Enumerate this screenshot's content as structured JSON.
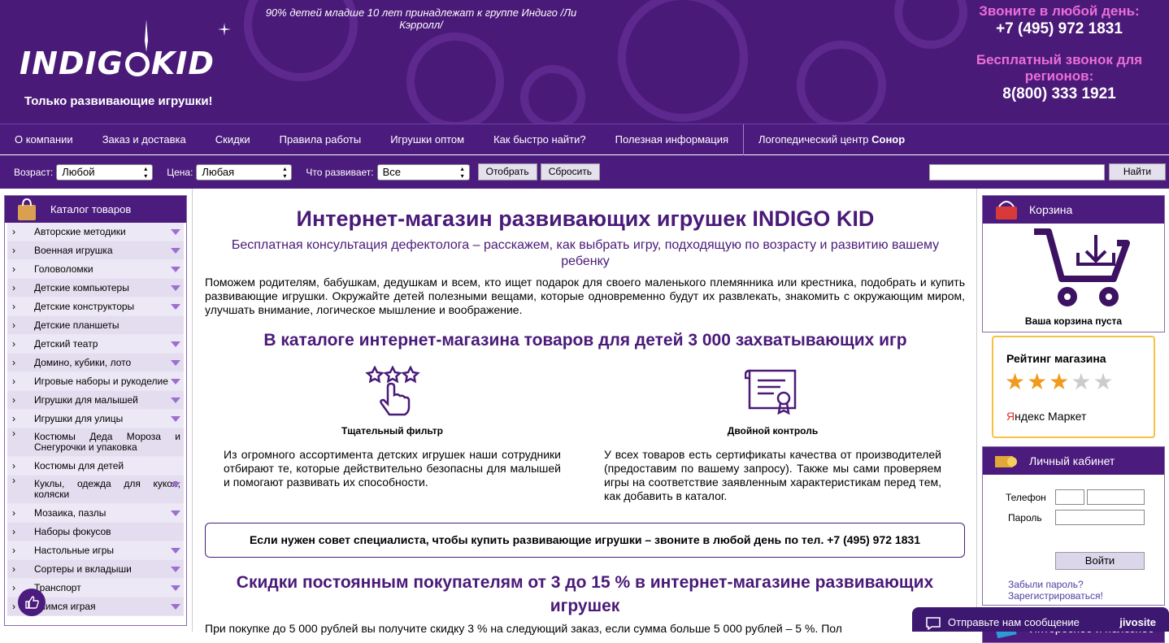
{
  "header": {
    "logo_left": "INDIG",
    "logo_right": "KID",
    "slogan": "Только развивающие игрушки!",
    "quote": "90% детей младше 10 лет принадлежат к группе Индиго /Ли Кэрролл/",
    "call_any_day": "Звоните в любой день:",
    "phone_main": "+7 (495) 972 1831",
    "free_call": "Бесплатный звонок для регионов:",
    "phone_free": "8(800) 333 1921"
  },
  "nav": {
    "items": [
      "О компании",
      "Заказ и доставка",
      "Скидки",
      "Правила работы",
      "Игрушки оптом",
      "Как быстро найти?",
      "Полезная информация"
    ],
    "logo_center_prefix": "Логопедический центр ",
    "logo_center_name": "Сонор"
  },
  "filter": {
    "age_label": "Возраст:",
    "age_value": "Любой",
    "price_label": "Цена:",
    "price_value": "Любая",
    "develops_label": "Что развивает:",
    "develops_value": "Все",
    "apply": "Отобрать",
    "reset": "Сбросить",
    "search_button": "Найти",
    "search_value": ""
  },
  "catalog": {
    "title": "Каталог товаров",
    "items": [
      {
        "label": "Авторские методики",
        "sub": true
      },
      {
        "label": "Военная игрушка",
        "sub": true
      },
      {
        "label": "Головоломки",
        "sub": true
      },
      {
        "label": "Детские компьютеры",
        "sub": true
      },
      {
        "label": "Детские конструкторы",
        "sub": true
      },
      {
        "label": "Детские планшеты",
        "sub": false
      },
      {
        "label": "Детский театр",
        "sub": true
      },
      {
        "label": "Домино, кубики, лото",
        "sub": true
      },
      {
        "label": "Игровые наборы и рукоделие",
        "sub": true
      },
      {
        "label": "Игрушки для малышей",
        "sub": true
      },
      {
        "label": "Игрушки для улицы",
        "sub": true
      },
      {
        "label": "Костюмы Деда Мороза и Снегурочки и упаковка",
        "sub": false
      },
      {
        "label": "Костюмы для детей",
        "sub": false
      },
      {
        "label": "Куклы, одежда для кукол, коляски",
        "sub": true
      },
      {
        "label": "Мозаика, пазлы",
        "sub": true
      },
      {
        "label": "Наборы фокусов",
        "sub": false
      },
      {
        "label": "Настольные игры",
        "sub": true
      },
      {
        "label": "Сортеры и вкладыши",
        "sub": true
      },
      {
        "label": "Транспорт",
        "sub": true
      },
      {
        "label": "Учимся играя",
        "sub": true
      }
    ]
  },
  "main": {
    "title": "Интернет-магазин развивающих игрушек INDIGO KID",
    "subtitle": "Бесплатная консультация дефектолога – расскажем, как выбрать игру, подходящую по возрасту и развитию вашему ребенку",
    "intro": "Поможем родителям, бабушкам, дедушкам и всем, кто ищет подарок для своего маленького племянника или крестника, подобрать и купить развивающие игрушки. Окружайте детей полезными вещами, которые одновременно будут их развлекать, знакомить с окружающим миром, улучшать внимание, логическое мышление и воображение.",
    "catalog_heading": "В каталоге интернет-магазина товаров для детей 3 000 захватывающих игр",
    "feature1_title": "Тщательный фильтр",
    "feature1_text": "Из огромного ассортимента детских игрушек наши сотрудники отбирают те, которые действительно безопасны для малышей и помогают развивать их способности.",
    "feature2_title": "Двойной контроль",
    "feature2_text": "У всех товаров есть сертификаты качества от производителей (предоставим по вашему запросу). Также мы сами проверяем игры на соответствие заявленным характеристикам перед тем, как добавить в каталог.",
    "advice": "Если нужен совет специалиста, чтобы купить развивающие игрушки – звоните в любой день по тел. +7 (495) 972 1831",
    "discount_heading": "Скидки постоянным покупателям от 3 до 15 % в интернет-магазине развивающих игрушек",
    "discount_text": "При покупке до 5 000 рублей вы получите скидку 3 % на следующий заказ, если сумма больше 5 000 рублей – 5 %. Пол"
  },
  "sidebar": {
    "cart_title": "Корзина",
    "cart_empty": "Ваша корзина пуста",
    "rating_title": "Рейтинг магазина",
    "rating_value": 3,
    "rating_max": 5,
    "yandex_y": "Я",
    "yandex_rest": "ндекс Маркет",
    "login_title": "Личный кабинет",
    "phone_label": "Телефон",
    "password_label": "Пароль",
    "login_button": "Войти",
    "forgot": "Забыли пароль?",
    "register": "Зарегистрироваться!",
    "useful_title": "Интересное и полезное"
  },
  "chat": {
    "label": "Отправьте нам сообщение",
    "brand": "jivosite"
  },
  "colors": {
    "brand_purple": "#4b1b7d",
    "accent_pink": "#ea6ed8",
    "star_on": "#f09a1e"
  }
}
